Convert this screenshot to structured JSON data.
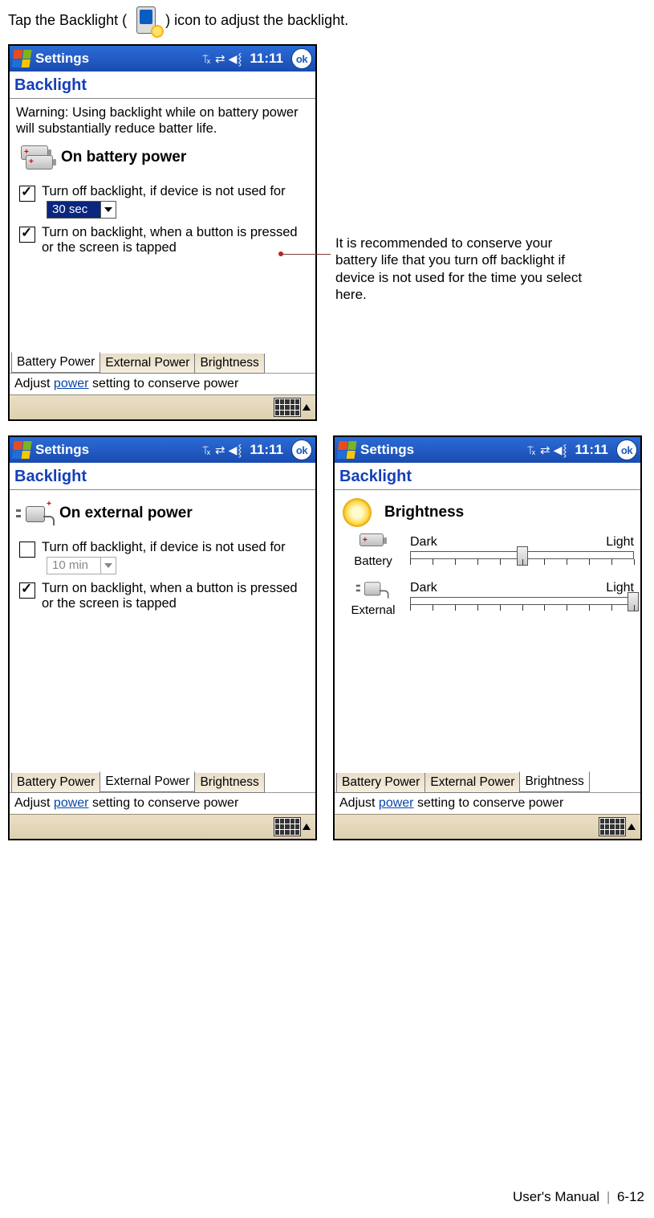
{
  "intro": {
    "pre": "Tap the Backlight (",
    "post": ") icon to adjust the backlight."
  },
  "callout": "It is recommended to conserve your battery life that you turn off backlight if device is not used for the time you select here.",
  "footer": {
    "label": "User's Manual",
    "page": "6-12"
  },
  "common": {
    "titlebar": {
      "title": "Settings",
      "time": "11:11",
      "ok": "ok"
    },
    "header": "Backlight",
    "tabs": {
      "battery": "Battery Power",
      "external": "External Power",
      "brightness": "Brightness"
    },
    "hint": {
      "pre": "Adjust ",
      "link": "power",
      "post": " setting to conserve power"
    }
  },
  "screen1": {
    "warning": "Warning: Using backlight while on battery power will substantially reduce batter life.",
    "section": "On battery power",
    "opt1": {
      "checked": true,
      "label": "Turn off backlight, if device is not used for",
      "dropdown": "30 sec"
    },
    "opt2": {
      "checked": true,
      "label": "Turn on backlight, when a button is pressed or the screen is tapped"
    },
    "active_tab": "battery"
  },
  "screen2": {
    "section": "On external power",
    "opt1": {
      "checked": false,
      "label": "Turn off backlight, if device is not used for",
      "dropdown": "10 min"
    },
    "opt2": {
      "checked": true,
      "label": "Turn on backlight, when a button is pressed or the screen is tapped"
    },
    "active_tab": "external"
  },
  "screen3": {
    "section": "Brightness",
    "slider_labels": {
      "dark": "Dark",
      "light": "Light"
    },
    "rows": {
      "battery": {
        "label": "Battery",
        "value": 5,
        "max": 10
      },
      "external": {
        "label": "External",
        "value": 10,
        "max": 10
      }
    },
    "active_tab": "brightness"
  }
}
